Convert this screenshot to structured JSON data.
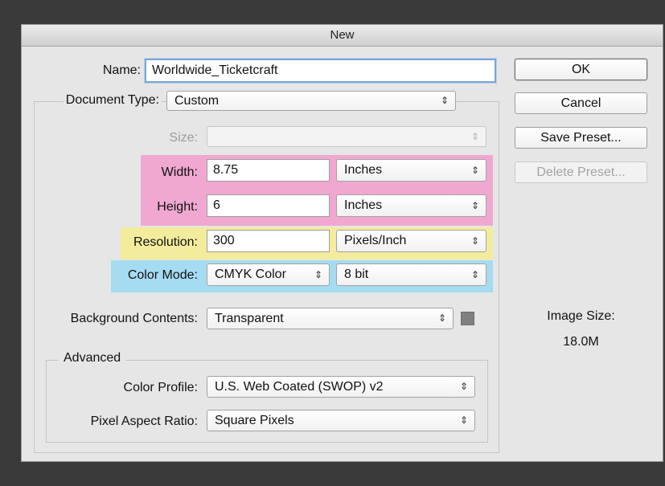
{
  "window": {
    "title": "New"
  },
  "form": {
    "name_label": "Name:",
    "name_value": "Worldwide_Ticketcraft",
    "doc_type_label": "Document Type:",
    "doc_type_value": "Custom",
    "size_label": "Size:",
    "size_value": "",
    "width_label": "Width:",
    "width_value": "8.75",
    "width_unit": "Inches",
    "height_label": "Height:",
    "height_value": "6",
    "height_unit": "Inches",
    "resolution_label": "Resolution:",
    "resolution_value": "300",
    "resolution_unit": "Pixels/Inch",
    "color_mode_label": "Color Mode:",
    "color_mode_value": "CMYK Color",
    "bit_depth_value": "8 bit",
    "background_label": "Background Contents:",
    "background_value": "Transparent"
  },
  "advanced": {
    "title": "Advanced",
    "color_profile_label": "Color Profile:",
    "color_profile_value": "U.S. Web Coated (SWOP) v2",
    "pixel_aspect_label": "Pixel Aspect Ratio:",
    "pixel_aspect_value": "Square Pixels"
  },
  "buttons": {
    "ok": "OK",
    "cancel": "Cancel",
    "save_preset": "Save Preset...",
    "delete_preset": "Delete Preset..."
  },
  "image_size": {
    "label": "Image Size:",
    "value": "18.0M"
  },
  "icons": {
    "dropdown": "⇕",
    "select_arrow": "select-arrow-icon"
  },
  "colors": {
    "highlight_pink": "#f0a8d0",
    "highlight_yellow": "#f3ec9d",
    "highlight_blue": "#a6dcf1"
  }
}
